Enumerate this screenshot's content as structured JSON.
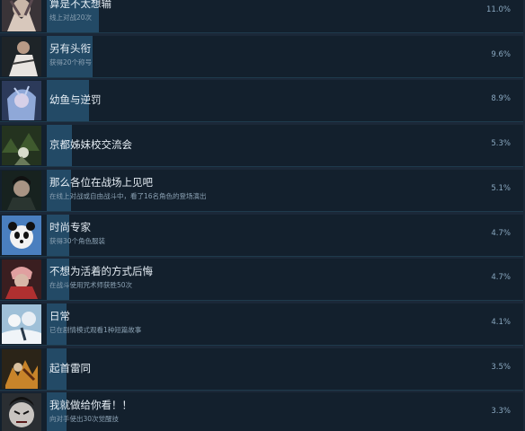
{
  "achievements": [
    {
      "title": "算是不太想输",
      "desc": "线上对战20次",
      "percent": "11.0%",
      "rate": 11.0,
      "icon": "cursed-hand-icon"
    },
    {
      "title": "另有头衔",
      "desc": "获得20个称号",
      "percent": "9.6%",
      "rate": 9.6,
      "icon": "white-robed-sorcerer-icon"
    },
    {
      "title": "幼鱼与逆罚",
      "desc": "",
      "percent": "8.9%",
      "rate": 8.9,
      "icon": "blue-haired-figure-icon"
    },
    {
      "title": "京都姊妹校交流会",
      "desc": "",
      "percent": "5.3%",
      "rate": 5.3,
      "icon": "forest-battle-icon"
    },
    {
      "title": "那么各位在战场上见吧",
      "desc": "在线上对战或自由战斗中，看了16名角色的登场演出",
      "percent": "5.1%",
      "rate": 5.1,
      "icon": "dark-haired-man-icon"
    },
    {
      "title": "时尚专家",
      "desc": "获得30个角色服装",
      "percent": "4.7%",
      "rate": 4.7,
      "icon": "panda-icon"
    },
    {
      "title": "不想为活着的方式后悔",
      "desc": "在战斗使用咒术师获胜50次",
      "percent": "4.7%",
      "rate": 4.7,
      "icon": "pink-haired-fighter-icon"
    },
    {
      "title": "日常",
      "desc": "已在剧情模式观看1种短篇故事",
      "percent": "4.1%",
      "rate": 4.1,
      "icon": "snow-scene-icon"
    },
    {
      "title": "起首雷同",
      "desc": "",
      "percent": "3.5%",
      "rate": 3.5,
      "icon": "fiery-fight-icon"
    },
    {
      "title": "我就做给你看！！",
      "desc": "向对手使出30次觉醒技",
      "percent": "3.3%",
      "rate": 3.3,
      "icon": "angry-face-icon"
    }
  ]
}
